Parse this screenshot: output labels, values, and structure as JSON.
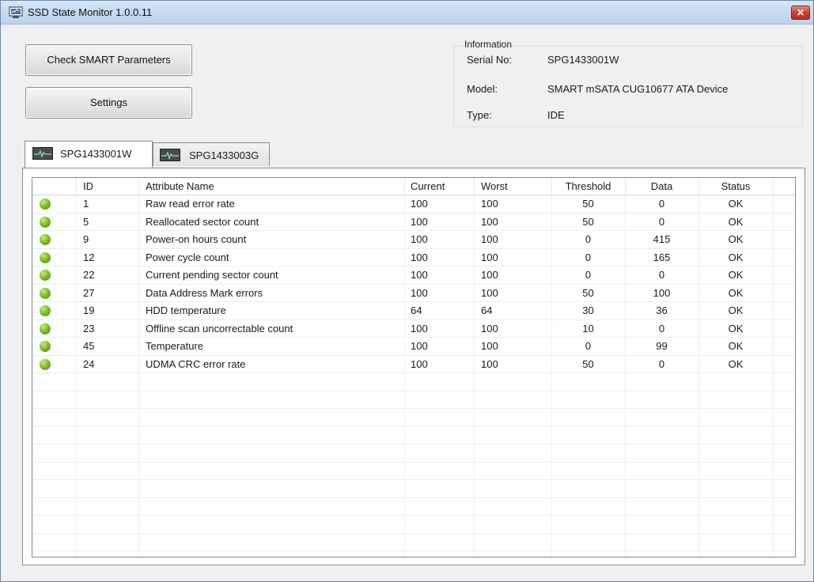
{
  "window": {
    "title": "SSD State Monitor 1.0.0.11",
    "close_label": "✕"
  },
  "toolbar": {
    "check_label": "Check SMART Parameters",
    "settings_label": "Settings"
  },
  "info": {
    "legend": "Information",
    "serial_label": "Serial No:",
    "serial": "SPG1433001W",
    "model_label": "Model:",
    "model": "SMART mSATA CUG10677 ATA Device",
    "type_label": "Type:",
    "type": "IDE"
  },
  "tabs": [
    {
      "label": "SPG1433001W",
      "icon": "drive-monitor-icon",
      "active": true
    },
    {
      "label": "SPG1433003G",
      "icon": "drive-monitor-icon",
      "active": false
    }
  ],
  "table": {
    "columns": [
      "",
      "ID",
      "Attribute Name",
      "Current",
      "Worst",
      "Threshold",
      "Data",
      "Status"
    ],
    "rows": [
      {
        "id": "1",
        "name": "Raw read error rate",
        "current": "100",
        "worst": "100",
        "threshold": "50",
        "data": "0",
        "status": "OK"
      },
      {
        "id": "5",
        "name": "Reallocated sector count",
        "current": "100",
        "worst": "100",
        "threshold": "50",
        "data": "0",
        "status": "OK"
      },
      {
        "id": "9",
        "name": "Power-on hours count",
        "current": "100",
        "worst": "100",
        "threshold": "0",
        "data": "415",
        "status": "OK"
      },
      {
        "id": "12",
        "name": "Power cycle count",
        "current": "100",
        "worst": "100",
        "threshold": "0",
        "data": "165",
        "status": "OK"
      },
      {
        "id": "22",
        "name": "Current pending sector count",
        "current": "100",
        "worst": "100",
        "threshold": "0",
        "data": "0",
        "status": "OK"
      },
      {
        "id": "27",
        "name": "Data Address Mark errors",
        "current": "100",
        "worst": "100",
        "threshold": "50",
        "data": "100",
        "status": "OK"
      },
      {
        "id": "19",
        "name": "HDD temperature",
        "current": "64",
        "worst": "64",
        "threshold": "30",
        "data": "36",
        "status": "OK"
      },
      {
        "id": "23",
        "name": "Offline scan uncorrectable count",
        "current": "100",
        "worst": "100",
        "threshold": "10",
        "data": "0",
        "status": "OK"
      },
      {
        "id": "45",
        "name": "Temperature",
        "current": "100",
        "worst": "100",
        "threshold": "0",
        "data": "99",
        "status": "OK"
      },
      {
        "id": "24",
        "name": "UDMA CRC error rate",
        "current": "100",
        "worst": "100",
        "threshold": "50",
        "data": "0",
        "status": "OK"
      }
    ]
  },
  "colors": {
    "status_ok": "#7fc02a",
    "titlebar": "#c8dbf1",
    "close": "#c8452f"
  }
}
